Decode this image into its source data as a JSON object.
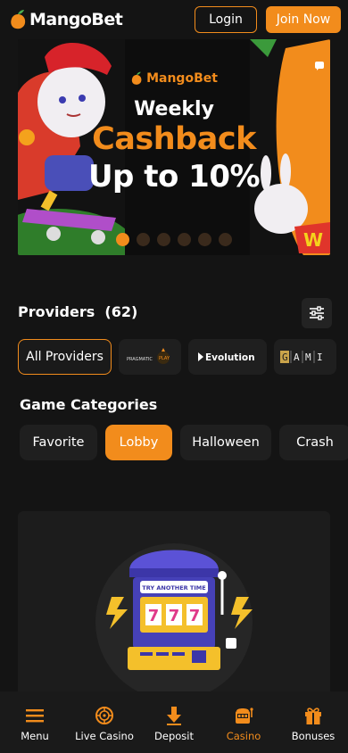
{
  "header": {
    "logo_text": "MangoBet",
    "login_label": "Login",
    "join_label": "Join Now"
  },
  "banner": {
    "brand": "MangoBet",
    "line1": "Weekly",
    "line2": "Cashback",
    "line3": "Up to 10%",
    "slide_count": 6,
    "active_slide": 1
  },
  "providers": {
    "title": "Providers",
    "count": "(62)",
    "items": [
      {
        "label": "All Providers",
        "selected": true
      },
      {
        "label": "PRAGMATIC PLAY",
        "logo": "pragmatic-play-logo"
      },
      {
        "label": "Evolution",
        "logo": "evolution-logo"
      },
      {
        "label": "GAMI",
        "logo": "gami-logo"
      }
    ]
  },
  "categories": {
    "title": "Game Categories",
    "items": [
      {
        "label": "Favorite",
        "selected": false
      },
      {
        "label": "Lobby",
        "selected": true
      },
      {
        "label": "Halloween",
        "selected": false
      },
      {
        "label": "Crash",
        "selected": false
      }
    ]
  },
  "empty_state": {
    "slot_text": "TRY ANOTHER TIME",
    "reels": [
      "7",
      "7",
      "7"
    ]
  },
  "bottom_nav": {
    "items": [
      {
        "label": "Menu",
        "icon": "menu-icon",
        "active": false
      },
      {
        "label": "Live Casino",
        "icon": "roulette-icon",
        "active": false
      },
      {
        "label": "Deposit",
        "icon": "deposit-arrow-icon",
        "active": false
      },
      {
        "label": "Casino",
        "icon": "slot-machine-icon",
        "active": true
      },
      {
        "label": "Bonuses",
        "icon": "gift-icon",
        "active": false
      }
    ]
  },
  "colors": {
    "accent": "#f28c1c",
    "background": "#141414",
    "surface": "#1f1f1f"
  }
}
